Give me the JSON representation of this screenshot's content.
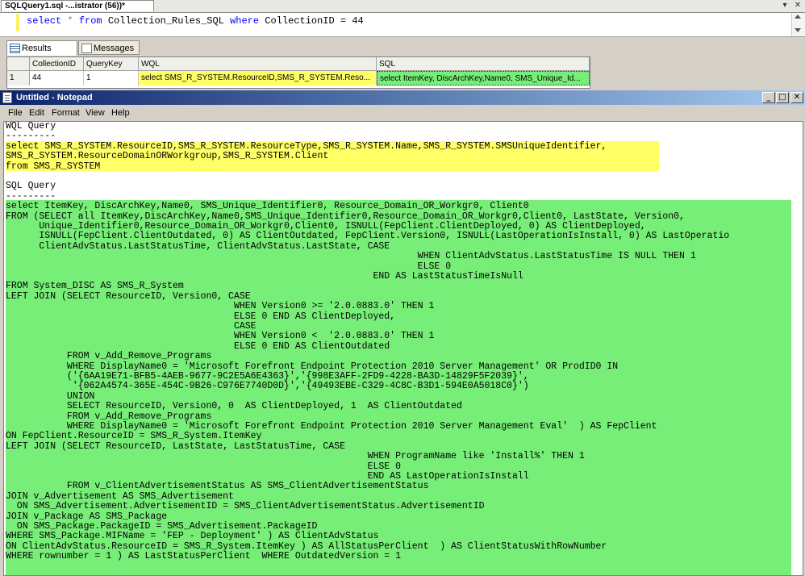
{
  "ssms": {
    "tab_title": "SQLQuery1.sql -...istrator (56))*",
    "query_parts": {
      "select": "select",
      "star": "*",
      "from": "from",
      "table": "Collection_Rules_SQL",
      "where": "where",
      "cond": "CollectionID = 44"
    },
    "results_tab": "Results",
    "messages_tab": "Messages",
    "columns": [
      "CollectionID",
      "QueryKey",
      "WQL",
      "SQL"
    ],
    "row": {
      "num": "1",
      "collection_id": "44",
      "query_key": "1",
      "wql": "select SMS_R_SYSTEM.ResourceID,SMS_R_SYSTEM.Reso...",
      "sql": "select ItemKey, DiscArchKey,Name0, SMS_Unique_Id..."
    },
    "colors": {
      "wql_cell": "#ffff66",
      "sql_cell": "#77ee77"
    }
  },
  "notepad": {
    "title": "Untitled - Notepad",
    "menu": [
      "File",
      "Edit",
      "Format",
      "View",
      "Help"
    ],
    "highlight_colors": {
      "wql": "#ffff66",
      "sql": "#77ee77"
    },
    "lines": [
      "WQL Query",
      "---------",
      "select SMS_R_SYSTEM.ResourceID,SMS_R_SYSTEM.ResourceType,SMS_R_SYSTEM.Name,SMS_R_SYSTEM.SMSUniqueIdentifier,",
      "SMS_R_SYSTEM.ResourceDomainORWorkgroup,SMS_R_SYSTEM.Client",
      "from SMS_R_SYSTEM",
      "",
      "SQL Query",
      "---------",
      "select ItemKey, DiscArchKey,Name0, SMS_Unique_Identifier0, Resource_Domain_OR_Workgr0, Client0",
      "FROM (SELECT all ItemKey,DiscArchKey,Name0,SMS_Unique_Identifier0,Resource_Domain_OR_Workgr0,Client0, LastState, Version0,",
      "      Unique_Identifier0,Resource_Domain_OR_Workgr0,Client0, ISNULL(FepClient.ClientDeployed, 0) AS ClientDeployed,",
      "      ISNULL(FepClient.ClientOutdated, 0) AS ClientOutdated, FepClient.Version0, ISNULL(LastOperationIsInstall, 0) AS LastOperatio",
      "      ClientAdvStatus.LastStatusTime, ClientAdvStatus.LastState, CASE",
      "                                                                          WHEN ClientAdvStatus.LastStatusTime IS NULL THEN 1",
      "                                                                          ELSE 0",
      "                                                                  END AS LastStatusTimeIsNull",
      "FROM System_DISC AS SMS_R_System",
      "LEFT JOIN (SELECT ResourceID, Version0, CASE",
      "                                         WHEN Version0 >= '2.0.0883.0' THEN 1",
      "                                         ELSE 0 END AS ClientDeployed,",
      "                                         CASE",
      "                                         WHEN Version0 <  '2.0.0883.0' THEN 1",
      "                                         ELSE 0 END AS ClientOutdated",
      "           FROM v_Add_Remove_Programs",
      "           WHERE DisplayName0 = 'Microsoft Forefront Endpoint Protection 2010 Server Management' OR ProdID0 IN",
      "           ('{6AA19E71-BFB5-4AEB-9677-9C2E5A6E4363}','{998E3AFF-2FD9-4228-BA3D-14829F5F2039}',",
      "            '{062A4574-365E-454C-9B26-C976E7740D0D}','{49493EBE-C329-4C8C-B3D1-594E0A5018C0}')",
      "           UNION",
      "           SELECT ResourceID, Version0, 0  AS ClientDeployed, 1  AS ClientOutdated",
      "           FROM v_Add_Remove_Programs",
      "           WHERE DisplayName0 = 'Microsoft Forefront Endpoint Protection 2010 Server Management Eval'  ) AS FepClient",
      "ON FepClient.ResourceID = SMS_R_System.ItemKey",
      "LEFT JOIN (SELECT ResourceID, LastState, LastStatusTime, CASE",
      "                                                                 WHEN ProgramName like 'Install%' THEN 1",
      "                                                                 ELSE 0",
      "                                                                 END AS LastOperationIsInstall",
      "           FROM v_ClientAdvertisementStatus AS SMS_ClientAdvertisementStatus",
      "JOIN v_Advertisement AS SMS_Advertisement",
      "  ON SMS_Advertisement.AdvertisementID = SMS_ClientAdvertisementStatus.AdvertisementID",
      "JOIN v_Package AS SMS_Package",
      "  ON SMS_Package.PackageID = SMS_Advertisement.PackageID",
      "WHERE SMS_Package.MIFName = 'FEP - Deployment' ) AS ClientAdvStatus",
      "ON ClientAdvStatus.ResourceID = SMS_R_System.ItemKey ) AS AllStatusPerClient  ) AS ClientStatusWithRowNumber",
      "WHERE rownumber = 1 ) AS LastStatusPerClient  WHERE OutdatedVersion = 1"
    ]
  }
}
